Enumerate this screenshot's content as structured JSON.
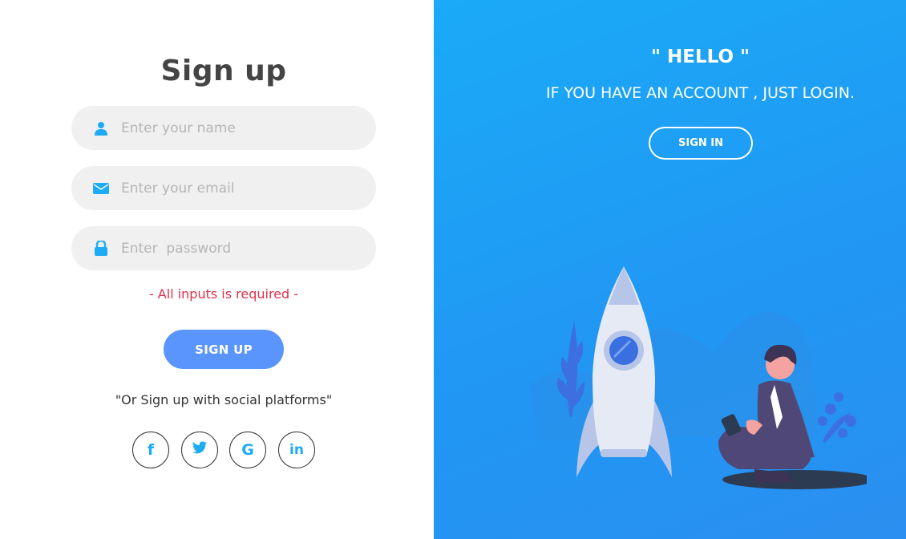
{
  "signup": {
    "title": "Sign up",
    "name_placeholder": "Enter your name",
    "email_placeholder": "Enter your email",
    "password_placeholder": "Enter  password",
    "error": "- All inputs is required -",
    "button": "SIGN UP",
    "social_text": "\"Or Sign up with social platforms\"",
    "social": [
      {
        "label": "f",
        "icon": "facebook-icon"
      },
      {
        "label": "t",
        "icon": "twitter-icon"
      },
      {
        "label": "G",
        "icon": "google-icon"
      },
      {
        "label": "in",
        "icon": "linkedin-icon"
      }
    ]
  },
  "panel": {
    "hello": "\" HELLO \"",
    "subtitle": "IF YOU HAVE AN ACCOUNT , JUST LOGIN.",
    "button": "SIGN IN"
  },
  "colors": {
    "accent": "#1eabf5",
    "button": "#5995fd",
    "error": "#e0314b",
    "panel": "#1da1f2"
  }
}
